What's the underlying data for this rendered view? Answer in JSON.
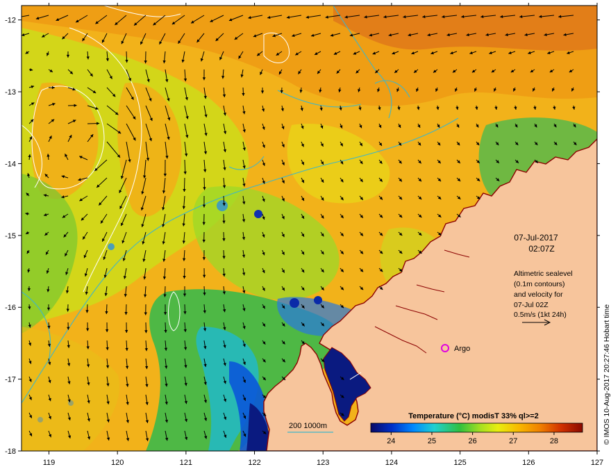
{
  "map": {
    "annotation": {
      "date": "07-Jul-2017",
      "time": "02:07Z",
      "altimetry_lines": [
        "Altimetric sealevel",
        "(0.1m contours)",
        "and velocity for",
        "07-Jul 02Z",
        "0.5m/s (1kt 24h)"
      ]
    },
    "station": {
      "label": "Argo",
      "lon": 124.8,
      "lat": -16.53
    },
    "credit": "© IMOS 10-Aug-2017 20:27:46 Hobart time",
    "isobath_label": "200  1000m",
    "colorbar": {
      "title": "Temperature (°C) modisT 33% ql>=2",
      "ticks": [
        "24",
        "25",
        "26",
        "27",
        "28"
      ],
      "range": [
        23.5,
        28.7
      ]
    },
    "axes": {
      "x_ticks": [
        "119",
        "120",
        "121",
        "122",
        "123",
        "124",
        "125",
        "126",
        "127"
      ],
      "y_ticks": [
        "-12",
        "-13",
        "-14",
        "-15",
        "-16",
        "-17",
        "-18"
      ],
      "lon_range": [
        118.6,
        127
      ],
      "lat_range": [
        -11.8,
        -18
      ]
    },
    "colors": {
      "land": "#f7c59c",
      "coastline": "#8b0000",
      "isobath": "#3fb6c8",
      "contour": "#ffffff",
      "arrow": "#000000",
      "station_marker": "#e000e0"
    }
  }
}
